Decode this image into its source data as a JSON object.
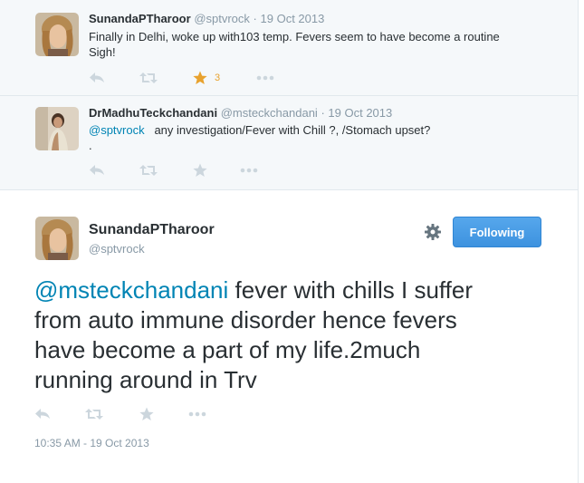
{
  "tweets": [
    {
      "name": "SunandaPTharoor",
      "handle": "@sptvrock",
      "date": "19 Oct 2013",
      "text_line1": "Finally in Delhi, woke up with103 temp. Fevers seem to have become a routine",
      "text_line2": "Sigh!",
      "favorites": "3"
    },
    {
      "name": "DrMadhuTeckchandani",
      "handle": "@msteckchandani",
      "date": "19 Oct 2013",
      "mention": "@sptvrock",
      "text_line1": "any investigation/Fever with Chill ?, /Stomach upset?",
      "text_line2": "."
    }
  ],
  "main_tweet": {
    "name": "SunandaPTharoor",
    "handle": "@sptvrock",
    "follow_label": "Following",
    "mention": "@msteckchandani",
    "text_line1": " fever with chills I suffer",
    "text_line2": "from auto immune disorder hence fevers",
    "text_line3": "have become a part of my life.2much",
    "text_line4": "running around in Trv",
    "timestamp": "10:35 AM - 19 Oct 2013"
  },
  "separator": "·",
  "icons": [
    "reply-icon",
    "retweet-icon",
    "favorite-icon",
    "more-icon",
    "gear-icon"
  ],
  "colors": {
    "link": "#0084b4",
    "favorite_active": "#e8a22e",
    "follow_button": "#3f96e3",
    "context_bg": "#f5f8fa"
  }
}
